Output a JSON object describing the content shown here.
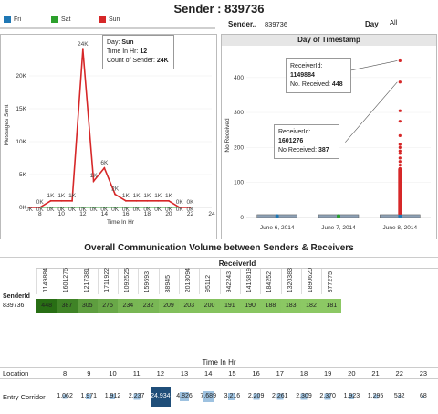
{
  "title": "Sender : 839736",
  "legend": [
    {
      "label": "Fri",
      "color": "#1f77b4"
    },
    {
      "label": "Sat",
      "color": "#2ca02c"
    },
    {
      "label": "Sun",
      "color": "#d62728"
    }
  ],
  "filters": {
    "sender_label": "Sender..",
    "sender_value": "839736",
    "day_label": "Day",
    "day_value": "All"
  },
  "line_chart": {
    "ylabel": "Messages Sent",
    "xlabel": "Time In Hr",
    "tooltip": {
      "day_label": "Day:",
      "day_value": "Sun",
      "time_label": "Time In Hr:",
      "time_value": "12",
      "count_label": "Count of Sender:",
      "count_value": "24K"
    }
  },
  "box_chart": {
    "title": "Day of Timestamp",
    "ylabel": "No Received",
    "ann1": {
      "l1": "ReceiverId:",
      "v1": "1149884",
      "l2": "No. Received:",
      "v2": "448"
    },
    "ann2": {
      "l1": "ReceiverId:",
      "v1": "1601276",
      "l2": "No Received:",
      "v2": "387"
    }
  },
  "heatmap": {
    "section_title": "Overall Communication Volume between Senders & Receivers",
    "receiver_header": "ReceiverId",
    "sender_header": "SenderId",
    "sender": "839736",
    "receivers": [
      "1149884",
      "1601276",
      "1217381",
      "1711922",
      "1092525",
      "159693",
      "38945",
      "2013094",
      "95112",
      "942243",
      "1415819",
      "184252",
      "1320383",
      "1890620",
      "377275"
    ],
    "values": [
      448,
      387,
      305,
      275,
      234,
      232,
      209,
      203,
      200,
      191,
      190,
      188,
      183,
      182,
      181
    ]
  },
  "table": {
    "time_title": "Time In Hr",
    "location_header": "Location",
    "hours": [
      "8",
      "9",
      "10",
      "11",
      "12",
      "13",
      "14",
      "15",
      "16",
      "17",
      "18",
      "19",
      "20",
      "21",
      "22",
      "23"
    ],
    "row_label": "Entry Corridor",
    "values": [
      "1,062",
      "1,971",
      "1,912",
      "2,237",
      "24,934",
      "4,826",
      "7,689",
      "3,216",
      "2,209",
      "2,261",
      "2,309",
      "2,370",
      "1,923",
      "1,295",
      "532",
      "68"
    ]
  },
  "chart_data": [
    {
      "type": "line",
      "title": "",
      "xlabel": "Time In Hr",
      "ylabel": "Messages Sent",
      "x": [
        7,
        8,
        9,
        10,
        11,
        12,
        13,
        14,
        15,
        16,
        17,
        18,
        19,
        20,
        21,
        22
      ],
      "xticks": [
        8,
        10,
        12,
        14,
        16,
        18,
        20,
        22,
        24
      ],
      "yticks": [
        "0K",
        "5K",
        "10K",
        "15K",
        "20K"
      ],
      "ylim": [
        0,
        25000
      ],
      "xlim": [
        7,
        24
      ],
      "series": [
        {
          "name": "Fri",
          "color": "#1f77b4",
          "values": [
            0,
            0,
            0,
            0,
            0,
            0,
            0,
            0,
            0,
            0,
            0,
            0,
            0,
            0,
            0,
            0
          ]
        },
        {
          "name": "Sat",
          "color": "#2ca02c",
          "values": [
            0,
            0,
            0,
            0,
            0,
            0,
            0,
            0,
            0,
            0,
            0,
            0,
            0,
            0,
            0,
            0
          ]
        },
        {
          "name": "Sun",
          "color": "#d62728",
          "values": [
            0,
            0,
            1000,
            1000,
            1000,
            24000,
            4000,
            6000,
            2000,
            1000,
            1000,
            1000,
            1000,
            1000,
            0,
            0
          ]
        }
      ],
      "data_labels": {
        "top": [
          "0K",
          "1K",
          "1K",
          "1K",
          "24K",
          "1K",
          "6K",
          "2K",
          "1K",
          "1K",
          "1K",
          "1K",
          "1K",
          "0K",
          "0K"
        ],
        "bottom": [
          "0K",
          "0K",
          "0K",
          "0K",
          "0K",
          "0K",
          "0K",
          "0K",
          "0K",
          "0K",
          "0K",
          "0K",
          "0K",
          "0K",
          "0K",
          "0K"
        ]
      }
    },
    {
      "type": "scatter",
      "title": "Day of Timestamp",
      "xlabel": "",
      "ylabel": "No Received",
      "categories": [
        "June 6, 2014",
        "June 7, 2014",
        "June 8, 2014"
      ],
      "yticks": [
        0,
        100,
        200,
        300,
        400
      ],
      "ylim": [
        0,
        470
      ],
      "outliers": {
        "June 8, 2014": [
          448,
          387,
          305,
          275,
          234,
          209,
          200,
          190,
          183,
          170,
          160,
          150,
          140,
          130,
          120,
          110,
          100,
          95,
          90,
          85,
          80,
          75,
          70,
          65,
          60,
          55,
          50,
          45,
          40,
          35,
          30,
          25,
          20
        ]
      }
    }
  ]
}
